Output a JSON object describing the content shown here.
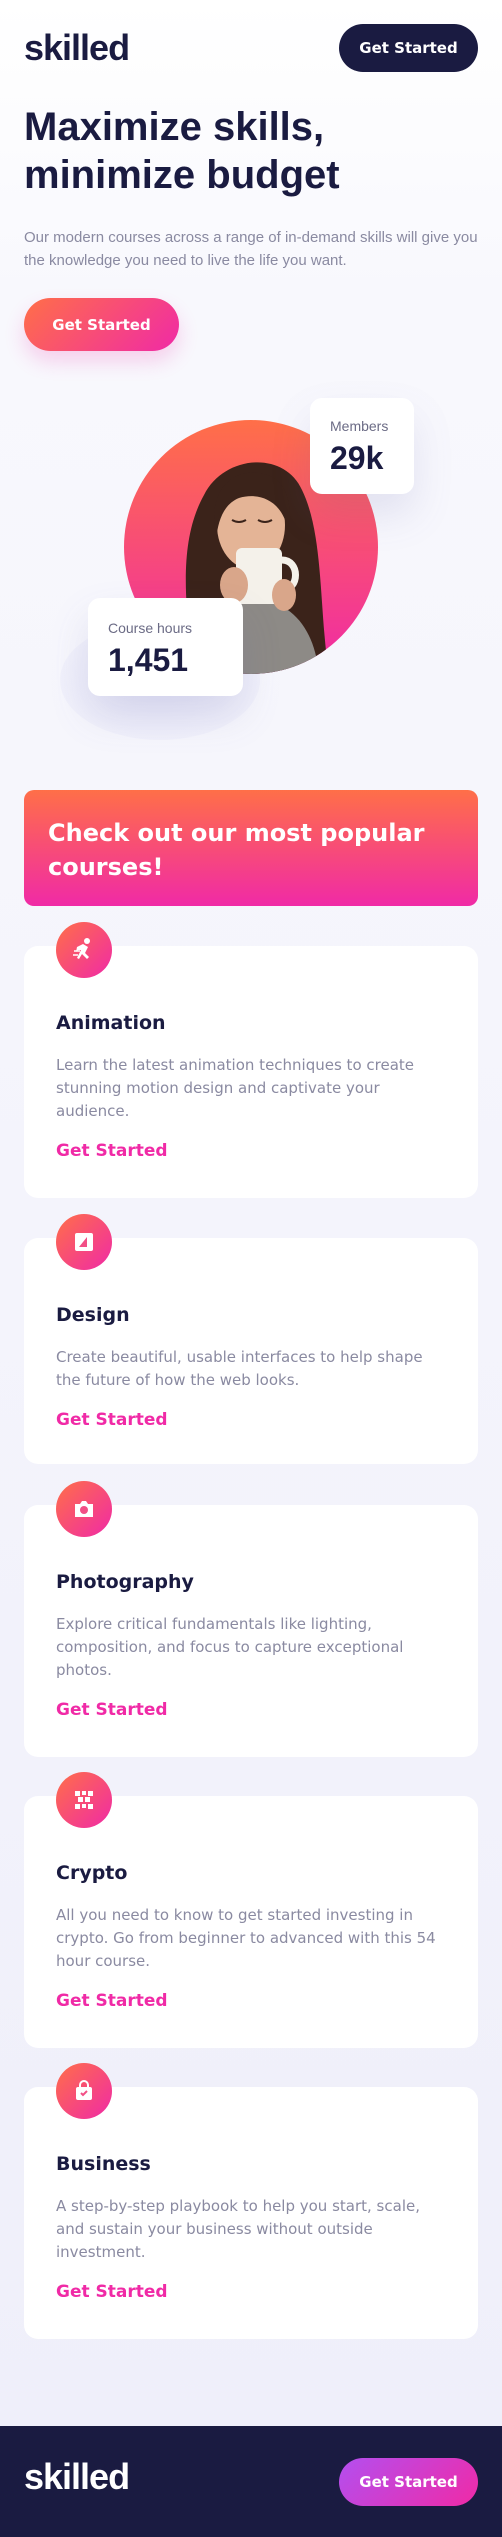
{
  "header": {
    "logo": "skilled",
    "cta_label": "Get Started"
  },
  "hero": {
    "title_line1": "Maximize skills,",
    "title_line2": "minimize budget",
    "subtitle": "Our modern courses across a range of in-demand skills will give you the knowledge you need to live the life you want.",
    "cta_label": "Get Started"
  },
  "stats": {
    "members": {
      "label": "Members",
      "value": "29k"
    },
    "hours": {
      "label": "Course hours",
      "value": "1,451"
    }
  },
  "banner": {
    "title": "Check out our most popular courses!"
  },
  "courses": [
    {
      "icon": "animation-icon",
      "title": "Animation",
      "description": "Learn the latest animation techniques to create stunning motion design and captivate your audience.",
      "link": "Get Started"
    },
    {
      "icon": "design-icon",
      "title": "Design",
      "description": "Create beautiful, usable interfaces to help shape the future of how the web looks.",
      "link": "Get Started"
    },
    {
      "icon": "camera-icon",
      "title": "Photography",
      "description": "Explore critical fundamentals like lighting, composition, and focus to capture exceptional photos.",
      "link": "Get Started"
    },
    {
      "icon": "crypto-icon",
      "title": "Crypto",
      "description": "All you need to know to get started investing in crypto. Go from beginner to advanced with this 54 hour course.",
      "link": "Get Started"
    },
    {
      "icon": "business-icon",
      "title": "Business",
      "description": "A step-by-step playbook to help you start, scale, and sustain your business without outside investment.",
      "link": "Get Started"
    }
  ],
  "footer": {
    "logo": "skilled",
    "cta_label": "Get Started"
  },
  "colors": {
    "navy": "#1a1b41",
    "orange": "#ff6f48",
    "pink": "#f02aa6",
    "purple": "#b34ff0",
    "gray_text": "#8a8aa1"
  }
}
